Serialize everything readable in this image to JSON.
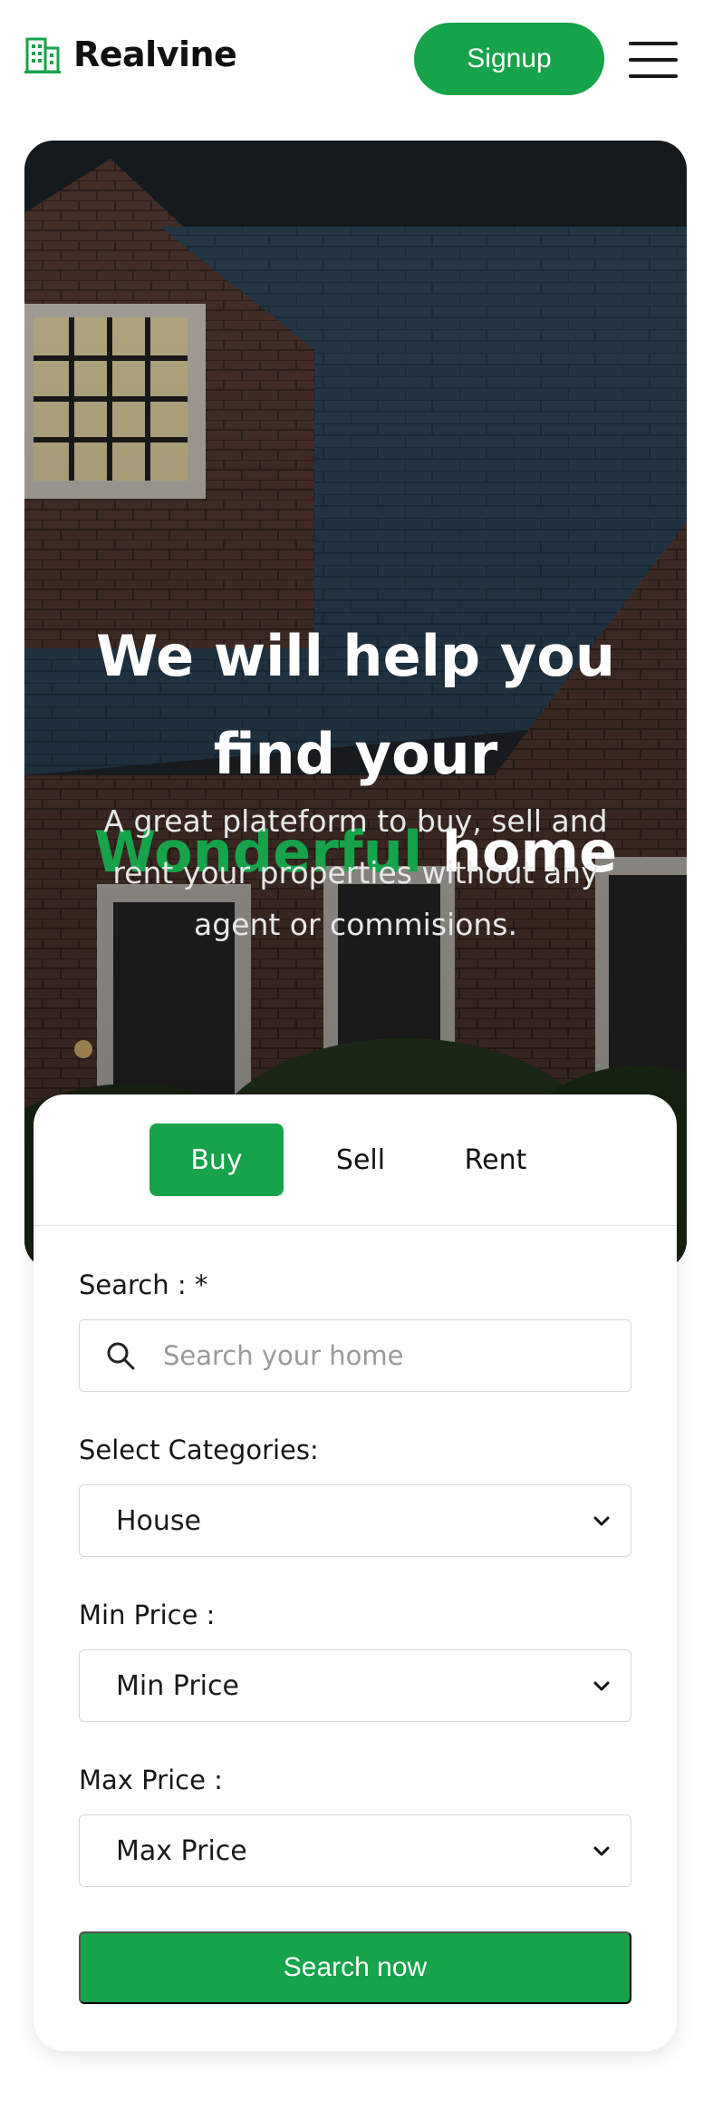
{
  "brand": {
    "name": "Realvine",
    "accent_color": "#16a34a"
  },
  "header": {
    "signup_label": "Signup",
    "menu_icon": "hamburger-menu-icon"
  },
  "hero": {
    "title_line1": "We will help you",
    "title_line2": "find your",
    "title_accent": "Wonderful",
    "title_end": " home",
    "subtitle": "A great plateform to buy, sell and rent your properties without any agent or commisions."
  },
  "search_card": {
    "tabs": [
      {
        "label": "Buy",
        "active": true
      },
      {
        "label": "Sell",
        "active": false
      },
      {
        "label": "Rent",
        "active": false
      }
    ],
    "search": {
      "label": "Search : *",
      "placeholder": "Search your home"
    },
    "category": {
      "label": "Select Categories:",
      "value": "House"
    },
    "min_price": {
      "label": "Min Price :",
      "value": "Min Price"
    },
    "max_price": {
      "label": "Max Price :",
      "value": "Max Price"
    },
    "submit_label": "Search now"
  }
}
